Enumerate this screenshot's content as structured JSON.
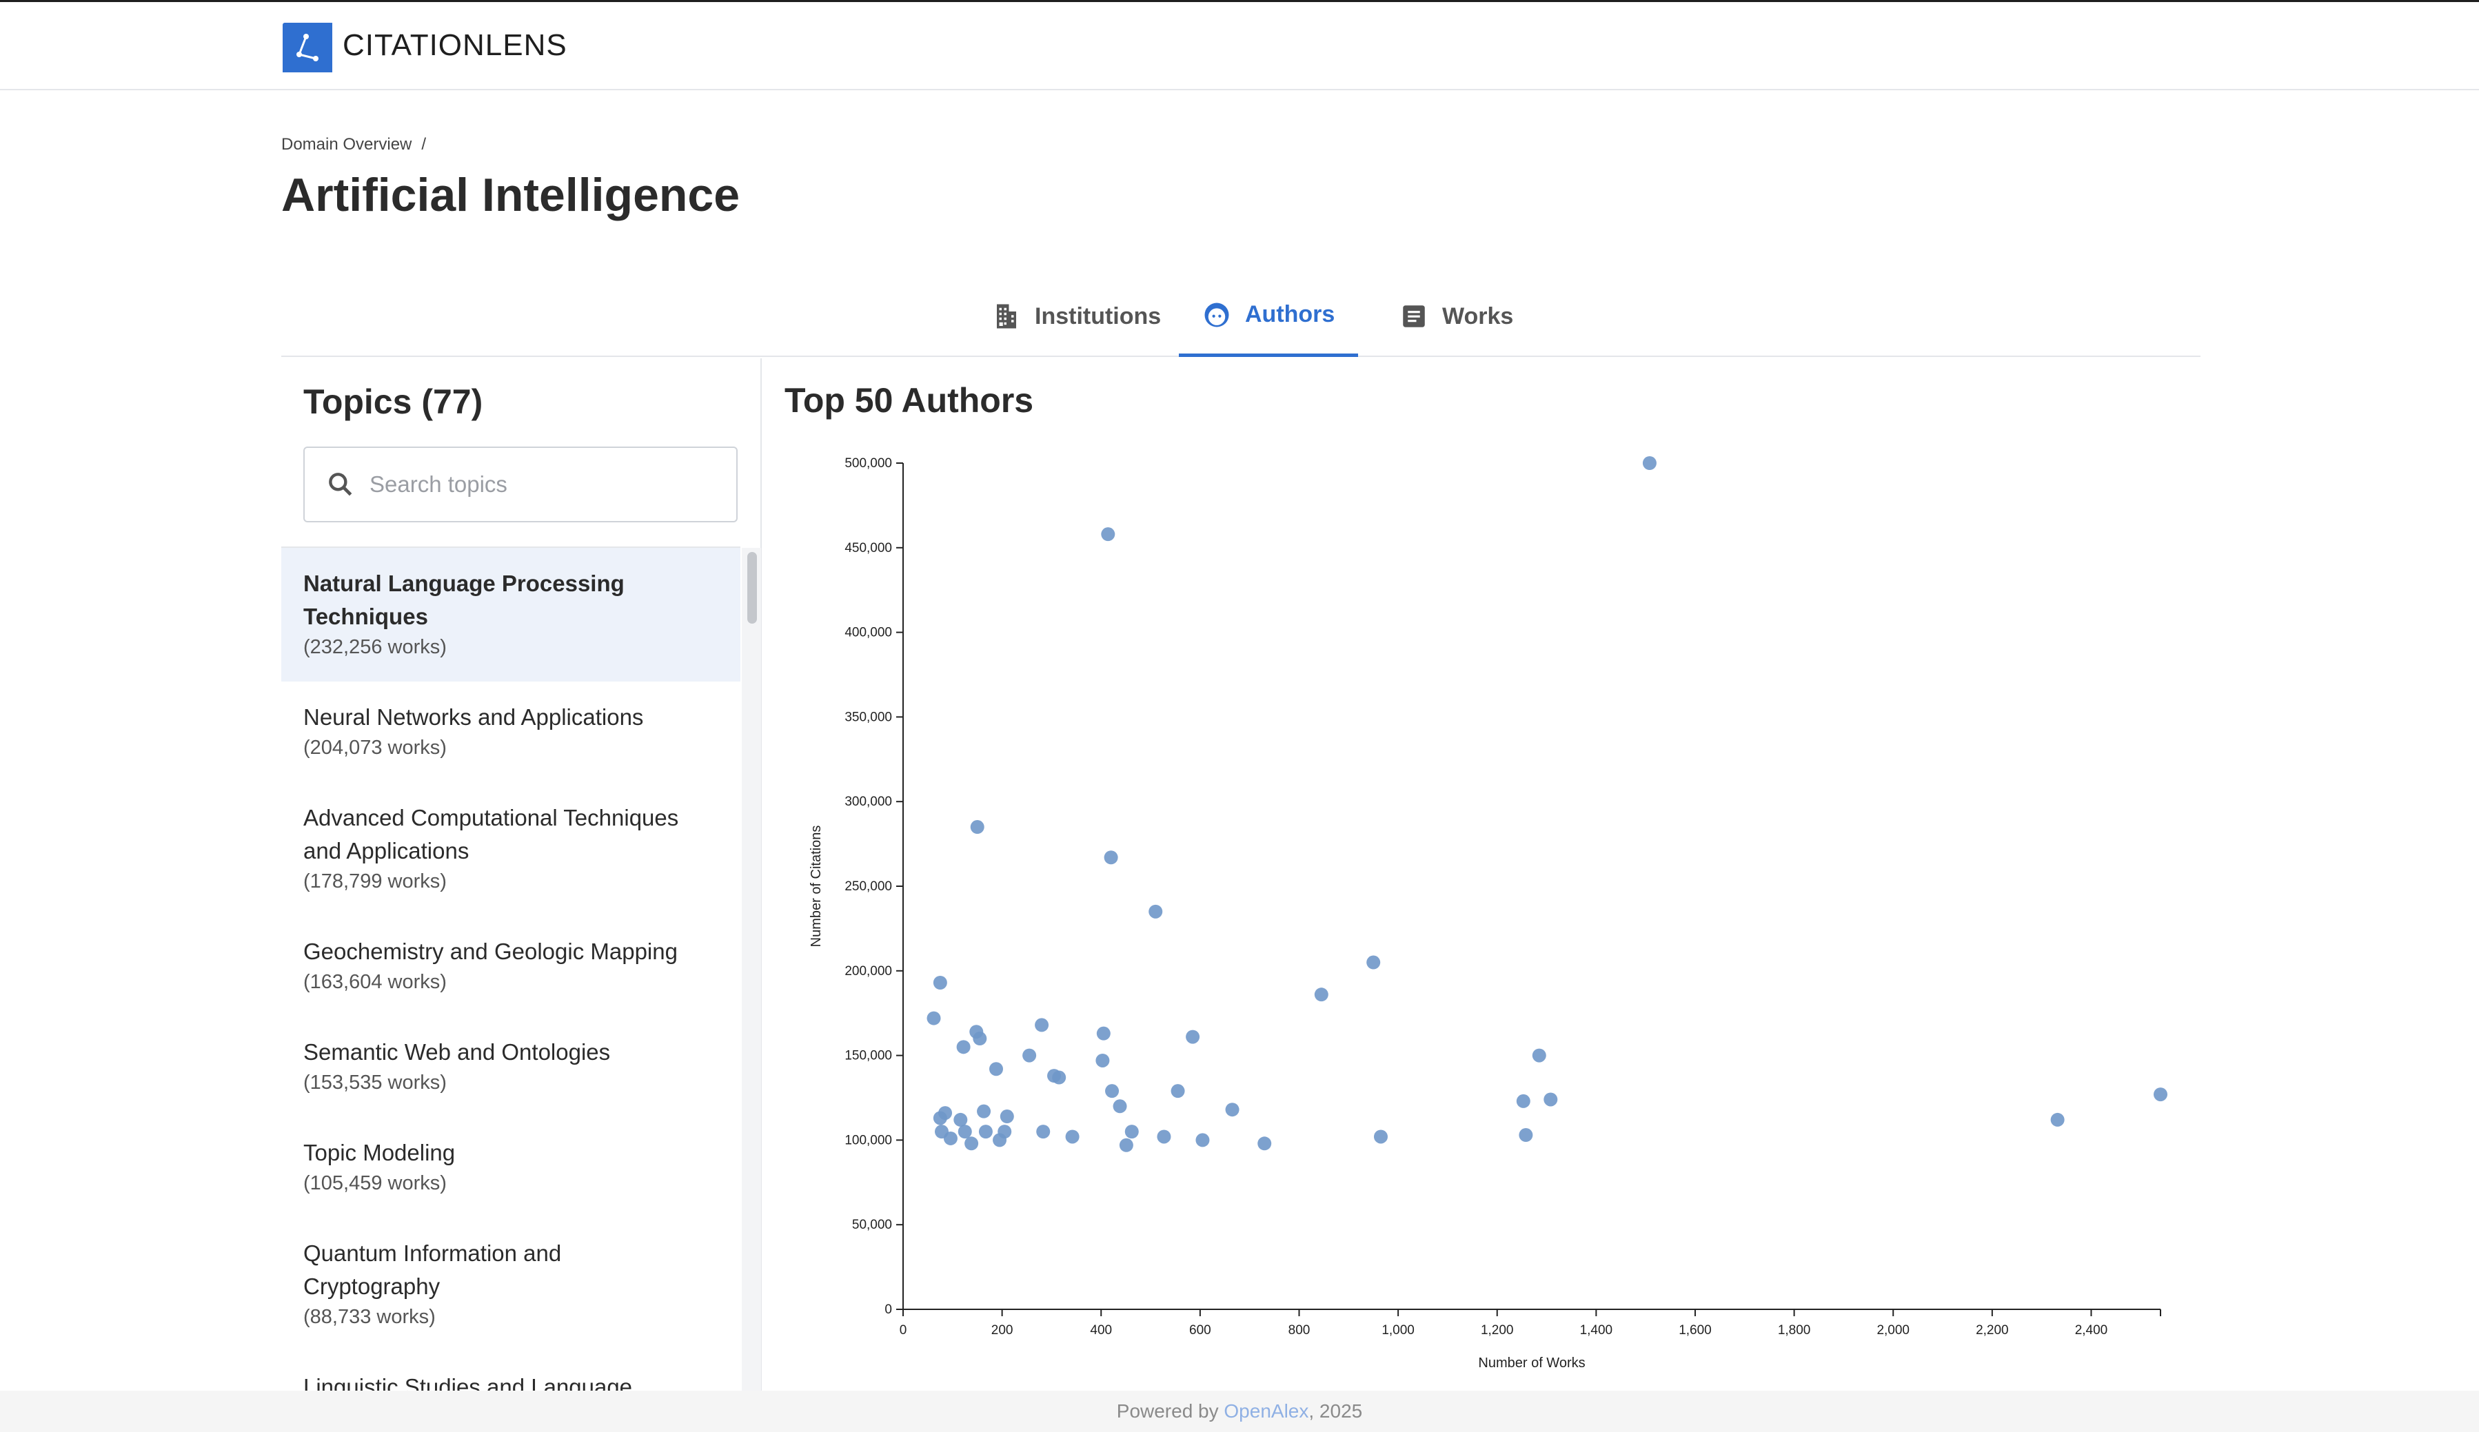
{
  "app": {
    "name": "CITATIONLENS"
  },
  "breadcrumb": {
    "items": [
      "Domain Overview"
    ],
    "separator": "/"
  },
  "page": {
    "title": "Artificial Intelligence"
  },
  "tabs": [
    {
      "label": "Institutions",
      "icon": "building-icon",
      "active": false
    },
    {
      "label": "Authors",
      "icon": "face-icon",
      "active": true
    },
    {
      "label": "Works",
      "icon": "document-icon",
      "active": false
    }
  ],
  "sidebar": {
    "title": "Topics (77)",
    "search": {
      "placeholder": "Search topics",
      "value": ""
    },
    "topics": [
      {
        "name": "Natural Language Processing Techniques",
        "count": "(232,256 works)",
        "selected": true
      },
      {
        "name": "Neural Networks and Applications",
        "count": "(204,073 works)"
      },
      {
        "name": "Advanced Computational Techniques and Applications",
        "count": "(178,799 works)"
      },
      {
        "name": "Geochemistry and Geologic Mapping",
        "count": "(163,604 works)"
      },
      {
        "name": "Semantic Web and Ontologies",
        "count": "(153,535 works)"
      },
      {
        "name": "Topic Modeling",
        "count": "(105,459 works)"
      },
      {
        "name": "Quantum Information and Cryptography",
        "count": "(88,733 works)"
      },
      {
        "name": "Linguistic Studies and Language",
        "count": ""
      }
    ]
  },
  "colors": {
    "accent": "#2f6fd0",
    "point": "#6f97c9"
  },
  "chart_data": {
    "type": "scatter",
    "title": "Top 50 Authors",
    "xlabel": "Number of Works",
    "ylabel": "Number of Citations",
    "xlim": [
      0,
      2540
    ],
    "ylim": [
      0,
      500000
    ],
    "xticks": [
      "0",
      "200",
      "400",
      "600",
      "800",
      "1,000",
      "1,200",
      "1,400",
      "1,600",
      "1,800",
      "2,000",
      "2,200",
      "2,400"
    ],
    "yticks": [
      "0",
      "50,000",
      "100,000",
      "150,000",
      "200,000",
      "250,000",
      "300,000",
      "350,000",
      "400,000",
      "450,000",
      "500,000"
    ],
    "points": [
      {
        "x": 1508,
        "y": 500000
      },
      {
        "x": 414,
        "y": 458000
      },
      {
        "x": 150,
        "y": 285000
      },
      {
        "x": 420,
        "y": 267000
      },
      {
        "x": 510,
        "y": 235000
      },
      {
        "x": 950,
        "y": 205000
      },
      {
        "x": 75,
        "y": 193000
      },
      {
        "x": 845,
        "y": 186000
      },
      {
        "x": 62,
        "y": 172000
      },
      {
        "x": 280,
        "y": 168000
      },
      {
        "x": 405,
        "y": 163000
      },
      {
        "x": 148,
        "y": 164000
      },
      {
        "x": 585,
        "y": 161000
      },
      {
        "x": 155,
        "y": 160000
      },
      {
        "x": 122,
        "y": 155000
      },
      {
        "x": 255,
        "y": 150000
      },
      {
        "x": 1285,
        "y": 150000
      },
      {
        "x": 403,
        "y": 147000
      },
      {
        "x": 188,
        "y": 142000
      },
      {
        "x": 305,
        "y": 138000
      },
      {
        "x": 315,
        "y": 137000
      },
      {
        "x": 555,
        "y": 129000
      },
      {
        "x": 422,
        "y": 129000
      },
      {
        "x": 2540,
        "y": 127000
      },
      {
        "x": 1308,
        "y": 124000
      },
      {
        "x": 1253,
        "y": 123000
      },
      {
        "x": 438,
        "y": 120000
      },
      {
        "x": 665,
        "y": 118000
      },
      {
        "x": 163,
        "y": 117000
      },
      {
        "x": 85,
        "y": 116000
      },
      {
        "x": 210,
        "y": 114000
      },
      {
        "x": 75,
        "y": 113000
      },
      {
        "x": 116,
        "y": 112000
      },
      {
        "x": 2332,
        "y": 112000
      },
      {
        "x": 78,
        "y": 105000
      },
      {
        "x": 125,
        "y": 105000
      },
      {
        "x": 167,
        "y": 105000
      },
      {
        "x": 205,
        "y": 105000
      },
      {
        "x": 283,
        "y": 105000
      },
      {
        "x": 462,
        "y": 105000
      },
      {
        "x": 1258,
        "y": 103000
      },
      {
        "x": 342,
        "y": 102000
      },
      {
        "x": 527,
        "y": 102000
      },
      {
        "x": 965,
        "y": 102000
      },
      {
        "x": 96,
        "y": 101000
      },
      {
        "x": 605,
        "y": 100000
      },
      {
        "x": 195,
        "y": 100000
      },
      {
        "x": 138,
        "y": 98000
      },
      {
        "x": 730,
        "y": 98000
      },
      {
        "x": 451,
        "y": 97000
      }
    ]
  },
  "footer": {
    "prefix": "Powered by ",
    "link": "OpenAlex",
    "suffix": ", 2025"
  }
}
